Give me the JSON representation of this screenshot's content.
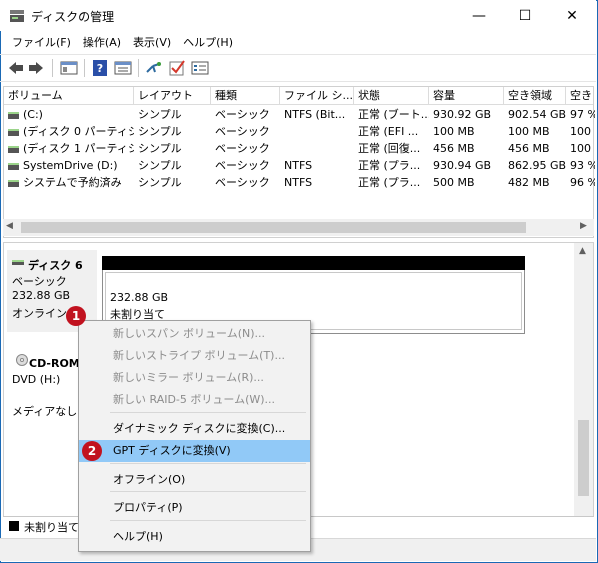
{
  "window": {
    "title": "ディスクの管理",
    "minimize": "—",
    "maximize": "☐",
    "close": "✕"
  },
  "menu": [
    "ファイル(F)",
    "操作(A)",
    "表示(V)",
    "ヘルプ(H)"
  ],
  "toolbar": {
    "icons": [
      "back-icon",
      "forward-icon",
      "console-tree-icon",
      "help-icon",
      "properties-icon",
      "connect-icon",
      "check-icon",
      "view-icon"
    ]
  },
  "columns": [
    "ボリューム",
    "レイアウト",
    "種類",
    "ファイル シ...",
    "状態",
    "容量",
    "空き領域",
    "空き"
  ],
  "volumes": [
    [
      "(C:)",
      "シンプル",
      "ベーシック",
      "NTFS (Bit...",
      "正常 (ブート...",
      "930.92 GB",
      "902.54 GB",
      "97 %"
    ],
    [
      "(ディスク 0 パーティシ...",
      "シンプル",
      "ベーシック",
      "",
      "正常 (EFI ...",
      "100 MB",
      "100 MB",
      "100 %"
    ],
    [
      "(ディスク 1 パーティシ...",
      "シンプル",
      "ベーシック",
      "",
      "正常 (回復...",
      "456 MB",
      "456 MB",
      "100 %"
    ],
    [
      "SystemDrive (D:)",
      "シンプル",
      "ベーシック",
      "NTFS",
      "正常 (プラ...",
      "930.94 GB",
      "862.95 GB",
      "93 %"
    ],
    [
      "システムで予約済み",
      "シンプル",
      "ベーシック",
      "NTFS",
      "正常 (プラ...",
      "500 MB",
      "482 MB",
      "96 %"
    ]
  ],
  "disk6": {
    "name": "ディスク 6",
    "type": "ベーシック",
    "size": "232.88 GB",
    "status": "オンライン",
    "partition_size": "232.88 GB",
    "partition_state": "未割り当て"
  },
  "cdrom": {
    "name": "CD-ROM",
    "drive": "DVD (H:)",
    "media": "メディアなし"
  },
  "legend": {
    "unallocated": "未割り当て"
  },
  "context_menu": {
    "items": [
      {
        "label": "新しいスパン ボリューム(N)...",
        "enabled": false
      },
      {
        "label": "新しいストライプ ボリューム(T)...",
        "enabled": false
      },
      {
        "label": "新しいミラー ボリューム(R)...",
        "enabled": false
      },
      {
        "label": "新しい RAID-5 ボリューム(W)...",
        "enabled": false
      },
      {
        "label": "ダイナミック ディスクに変換(C)...",
        "enabled": true
      },
      {
        "label": "GPT ディスクに変換(V)",
        "enabled": true,
        "highlighted": true
      },
      {
        "label": "オフライン(O)",
        "enabled": true
      },
      {
        "label": "プロパティ(P)",
        "enabled": true
      },
      {
        "label": "ヘルプ(H)",
        "enabled": true
      }
    ]
  },
  "step_badges": [
    "1",
    "2"
  ],
  "colors": {
    "highlight": "#91c9f7",
    "badge": "#c1121f",
    "unallocated": "#000000",
    "window_border": "#1a69b5"
  }
}
